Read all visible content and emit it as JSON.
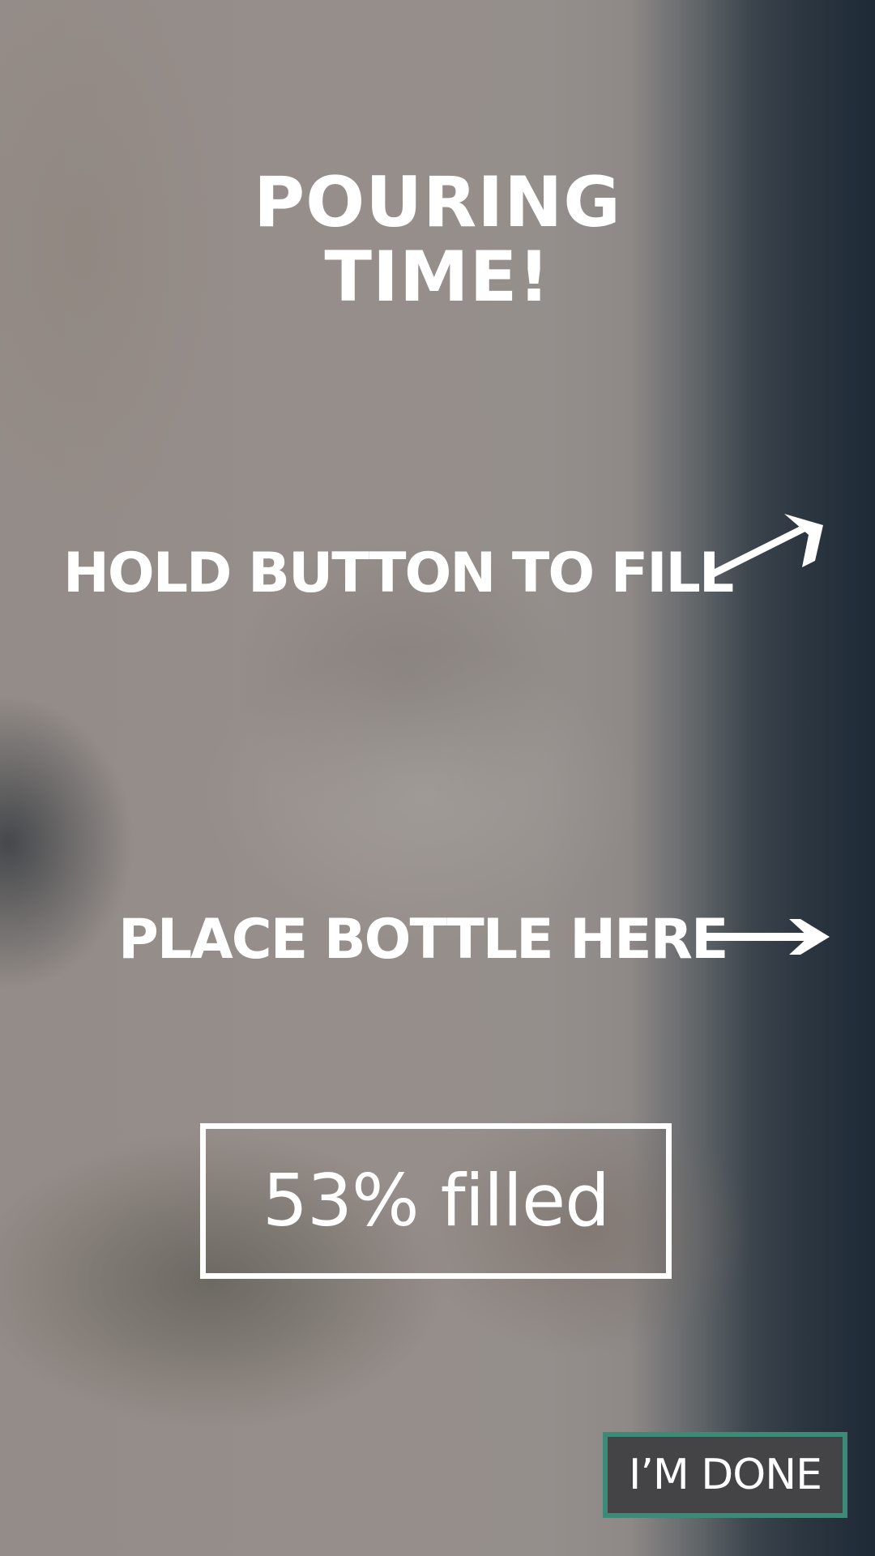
{
  "screen": {
    "title_line1": "POURING",
    "title_line2": "TIME!"
  },
  "instructions": {
    "hold": "HOLD BUTTON TO FILL",
    "place": "PLACE BOTTLE HERE"
  },
  "fill_status": {
    "percent": 53,
    "label": "53% filled"
  },
  "done_button": {
    "label": "I’M DONE"
  },
  "colors": {
    "text": "#ffffff",
    "button_border": "#3d8a78",
    "button_bg": "#444446"
  },
  "icons": {
    "hold_arrow": "arrow-up-right-icon",
    "place_arrow": "arrow-right-icon"
  }
}
